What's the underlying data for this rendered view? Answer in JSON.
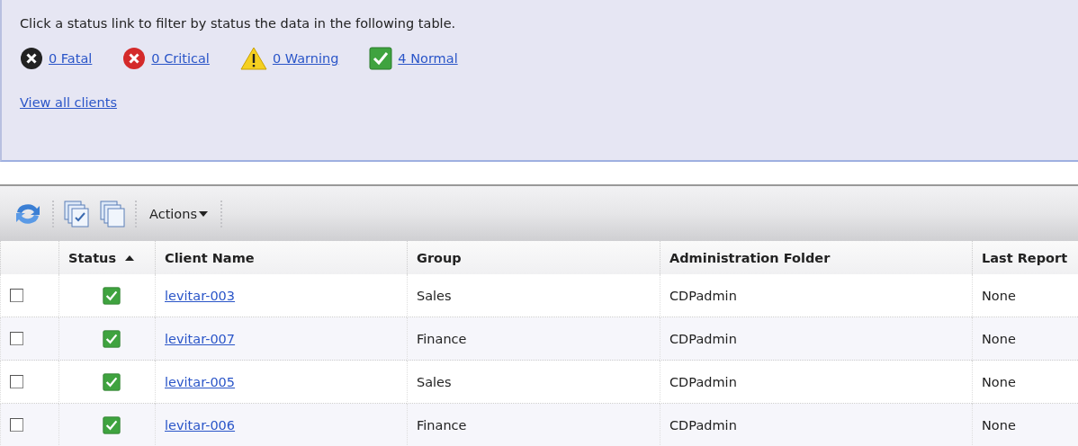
{
  "filter_panel": {
    "instruction": "Click a status link to filter by status the data in the following table.",
    "status_links": [
      {
        "kind": "fatal",
        "label": "0 Fatal"
      },
      {
        "kind": "critical",
        "label": "0 Critical"
      },
      {
        "kind": "warning",
        "label": "0 Warning"
      },
      {
        "kind": "normal",
        "label": "4 Normal"
      }
    ],
    "view_all_link": "View all clients"
  },
  "toolbar": {
    "actions_menu": "Actions"
  },
  "table": {
    "columns": [
      {
        "label": "Status",
        "sorted_ascending": true
      },
      {
        "label": "Client Name"
      },
      {
        "label": "Group"
      },
      {
        "label": "Administration Folder"
      },
      {
        "label": "Last Report"
      }
    ],
    "rows": [
      {
        "checked": false,
        "status": {
          "kind": "normal"
        },
        "client": "levitar-003",
        "group": "Sales",
        "folder": "CDPadmin",
        "last_report": "None"
      },
      {
        "checked": false,
        "status": {
          "kind": "normal"
        },
        "client": "levitar-007",
        "group": "Finance",
        "folder": "CDPadmin",
        "last_report": "None"
      },
      {
        "checked": false,
        "status": {
          "kind": "normal"
        },
        "client": "levitar-005",
        "group": "Sales",
        "folder": "CDPadmin",
        "last_report": "None"
      },
      {
        "checked": false,
        "status": {
          "kind": "normal"
        },
        "client": "levitar-006",
        "group": "Finance",
        "folder": "CDPadmin",
        "last_report": "None"
      }
    ]
  }
}
